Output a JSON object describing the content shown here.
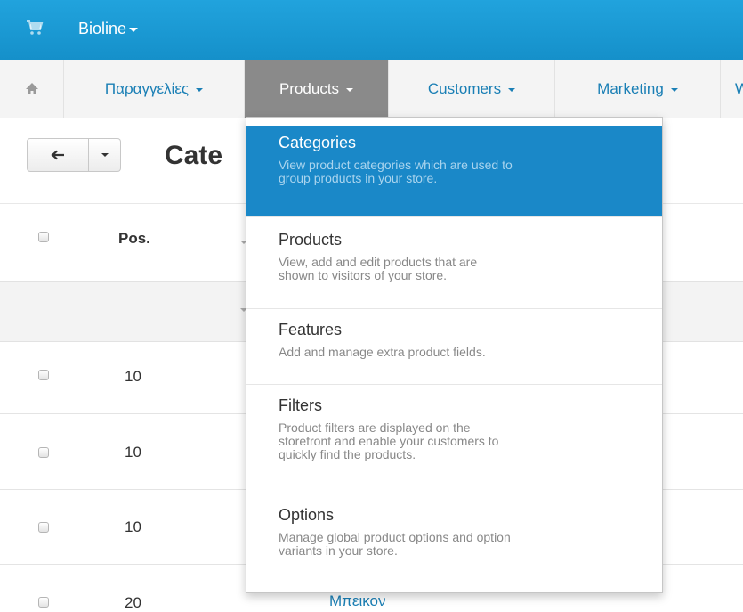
{
  "topbar": {
    "brand": "Bioline",
    "bg_color": "#1a9ad6",
    "cart_icon": "cart-icon"
  },
  "nav": {
    "home_icon": "home-icon",
    "items": [
      {
        "label": "Παραγγελίες",
        "active": false
      },
      {
        "label": "Products",
        "active": true
      },
      {
        "label": "Customers",
        "active": false
      },
      {
        "label": "Marketing",
        "active": false
      },
      {
        "label": "W",
        "active": false
      }
    ]
  },
  "toolbar": {
    "back_icon": "arrow-left-icon",
    "more_icon": "chevron-down-icon"
  },
  "page": {
    "title": "Cate"
  },
  "table": {
    "header_pos": "Pos.",
    "rows": [
      {
        "pos": "10",
        "name": ""
      },
      {
        "pos": "10",
        "name": ""
      },
      {
        "pos": "10",
        "name": ""
      },
      {
        "pos": "20",
        "name": "Μπεικον"
      }
    ]
  },
  "dropdown": {
    "items": [
      {
        "title": "Categories",
        "desc": [
          "View product categories which are used to",
          "group products in your store."
        ],
        "active": true
      },
      {
        "title": "Products",
        "desc": [
          "View, add and edit products that are",
          "shown to visitors of your store."
        ],
        "active": false
      },
      {
        "title": "Features",
        "desc": [
          "Add and manage extra product fields."
        ],
        "active": false
      },
      {
        "title": "Filters",
        "desc": [
          "Product filters are displayed on the",
          "storefront and enable your customers to",
          "quickly find the products."
        ],
        "active": false
      },
      {
        "title": "Options",
        "desc": [
          "Manage global product options and option",
          "variants in your store."
        ],
        "active": false
      }
    ]
  }
}
